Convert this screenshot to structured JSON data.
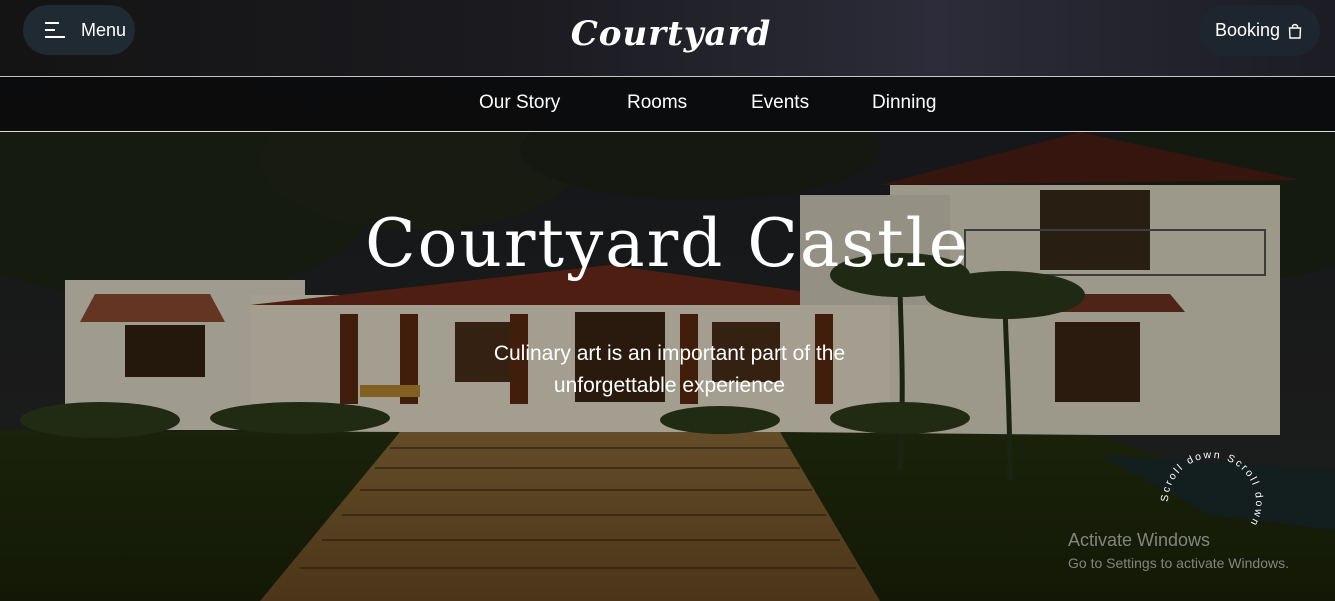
{
  "header": {
    "menu_label": "Menu",
    "logo_text": "Courtyard",
    "booking_label": "Booking"
  },
  "nav": {
    "items": [
      "Our Story",
      "Rooms",
      "Events",
      "Dinning"
    ]
  },
  "hero": {
    "title": "Courtyard Castle",
    "subtitle_line1": "Culinary art is an important part of the",
    "subtitle_line2": "unforgettable experience",
    "scroll_text": "Scroll down Scroll down "
  },
  "watermark": {
    "line1": "Activate Windows",
    "line2": "Go to Settings to activate Windows."
  },
  "icons": {
    "menu": "hamburger-icon",
    "booking": "shopping-bag-icon"
  }
}
